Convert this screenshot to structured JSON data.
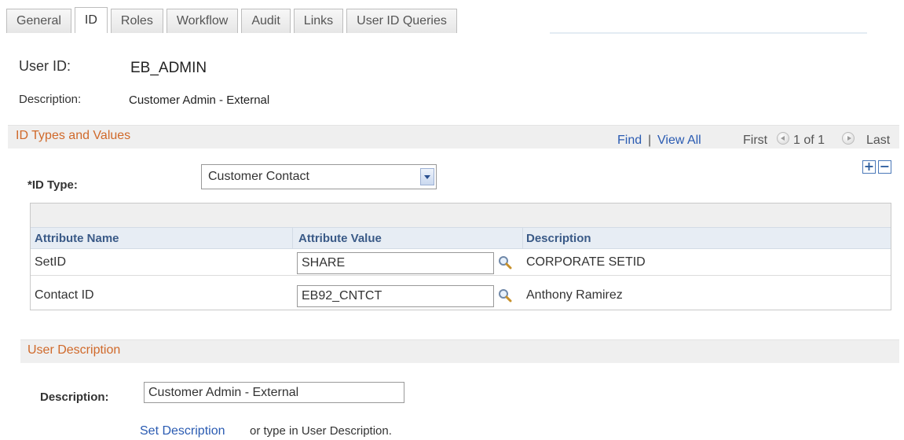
{
  "tabs": [
    "General",
    "ID",
    "Roles",
    "Workflow",
    "Audit",
    "Links",
    "User ID Queries"
  ],
  "active_tab": "ID",
  "user": {
    "id_label": "User ID:",
    "id_value": "EB_ADMIN",
    "desc_label": "Description:",
    "desc_value": "Customer Admin - External"
  },
  "id_section": {
    "title": "ID Types and Values",
    "find": "Find",
    "separator": "|",
    "view_all": "View All",
    "first": "First",
    "count": "1 of 1",
    "last": "Last",
    "add_symbol": "+",
    "remove_symbol": "−",
    "id_type_label": "*ID Type:",
    "id_type_value": "Customer Contact"
  },
  "grid": {
    "columns": [
      "Attribute Name",
      "Attribute Value",
      "Description"
    ],
    "rows": [
      {
        "name": "SetID",
        "value": "SHARE",
        "description": "CORPORATE SETID"
      },
      {
        "name": "Contact ID",
        "value": "EB92_CNTCT",
        "description": "Anthony Ramirez"
      }
    ]
  },
  "user_desc": {
    "title": "User Description",
    "label": "Description:",
    "value": "Customer Admin - External",
    "link": "Set Description",
    "hint": "or type in User Description."
  },
  "colors": {
    "accent_heading": "#d0692a",
    "link": "#2a5bb2",
    "grid_header_text": "#3a5a87"
  },
  "icons": [
    "prev-arrow-icon",
    "next-arrow-icon",
    "add-row-icon",
    "delete-row-icon",
    "dropdown-arrow-icon",
    "lookup-magnifier-icon"
  ]
}
